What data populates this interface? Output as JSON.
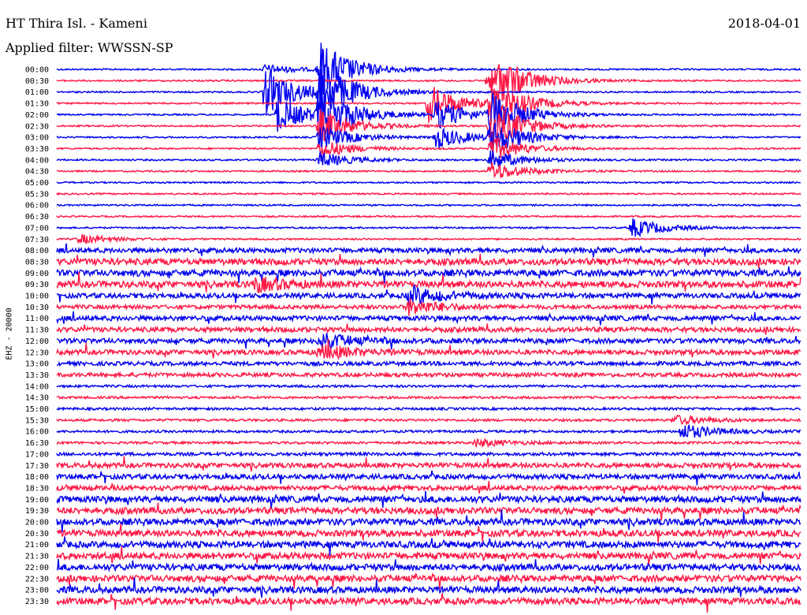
{
  "header": {
    "title": "HT Thira Isl. - Kameni",
    "date": "2018-04-01",
    "filter": "Applied filter: WWSSN-SP",
    "channel": "EHZ - 20000"
  },
  "colors": {
    "blue": "#0000ee",
    "red": "#ff1744"
  },
  "chart_data": {
    "type": "line",
    "title": "HT Thira Isl. - Kameni",
    "subtitle": "Applied filter: WWSSN-SP",
    "ylabel": "EHZ - 20000",
    "tick_labels": [
      "00:00",
      "00:30",
      "01:00",
      "01:30",
      "02:00",
      "02:30",
      "03:00",
      "03:30",
      "04:00",
      "04:30",
      "05:00",
      "05:30",
      "06:00",
      "06:30",
      "07:00",
      "07:30",
      "08:00",
      "08:30",
      "09:00",
      "09:30",
      "10:00",
      "10:30",
      "11:00",
      "11:30",
      "12:00",
      "12:30",
      "13:00",
      "13:30",
      "14:00",
      "14:30",
      "15:00",
      "15:30",
      "16:00",
      "16:30",
      "17:00",
      "17:30",
      "18:00",
      "18:30",
      "19:00",
      "19:30",
      "20:00",
      "20:30",
      "21:00",
      "21:30",
      "22:00",
      "22:30",
      "23:00",
      "23:30"
    ],
    "series_colors": [
      "blue",
      "red"
    ],
    "x_range_minutes_per_line": [
      0,
      30
    ],
    "noise_level_per_line": [
      1,
      1,
      1,
      1,
      1,
      1,
      1,
      1,
      1,
      1,
      1,
      1,
      1,
      1,
      1,
      1,
      3,
      4,
      4,
      4,
      3,
      2.5,
      3,
      3,
      3,
      3,
      2.5,
      2.5,
      1.5,
      1.5,
      1.5,
      1.5,
      1.5,
      1.5,
      2,
      3,
      3,
      3,
      4,
      4,
      4,
      4,
      4,
      4,
      4,
      4,
      4,
      4
    ],
    "events": [
      {
        "line": 0,
        "minute": 8.4,
        "amplitude": 6
      },
      {
        "line": 0,
        "minute": 10.6,
        "amplitude": 36
      },
      {
        "line": 1,
        "minute": 17.4,
        "amplitude": 14
      },
      {
        "line": 1,
        "minute": 17.8,
        "amplitude": 22
      },
      {
        "line": 2,
        "minute": 8.4,
        "amplitude": 30
      },
      {
        "line": 2,
        "minute": 10.6,
        "amplitude": 36
      },
      {
        "line": 3,
        "minute": 15.0,
        "amplitude": 24
      },
      {
        "line": 3,
        "minute": 17.5,
        "amplitude": 30
      },
      {
        "line": 4,
        "minute": 8.9,
        "amplitude": 22
      },
      {
        "line": 4,
        "minute": 10.6,
        "amplitude": 34
      },
      {
        "line": 4,
        "minute": 15.3,
        "amplitude": 18
      },
      {
        "line": 4,
        "minute": 17.5,
        "amplitude": 28
      },
      {
        "line": 5,
        "minute": 10.6,
        "amplitude": 22
      },
      {
        "line": 5,
        "minute": 17.5,
        "amplitude": 30
      },
      {
        "line": 6,
        "minute": 10.6,
        "amplitude": 16
      },
      {
        "line": 6,
        "minute": 15.3,
        "amplitude": 14
      },
      {
        "line": 6,
        "minute": 17.5,
        "amplitude": 22
      },
      {
        "line": 7,
        "minute": 10.6,
        "amplitude": 12
      },
      {
        "line": 7,
        "minute": 17.5,
        "amplitude": 16
      },
      {
        "line": 8,
        "minute": 10.6,
        "amplitude": 10
      },
      {
        "line": 8,
        "minute": 17.5,
        "amplitude": 12
      },
      {
        "line": 9,
        "minute": 17.5,
        "amplitude": 12
      },
      {
        "line": 14,
        "minute": 23.2,
        "amplitude": 12
      },
      {
        "line": 15,
        "minute": 0.9,
        "amplitude": 6
      },
      {
        "line": 19,
        "minute": 8.0,
        "amplitude": 8
      },
      {
        "line": 20,
        "minute": 14.2,
        "amplitude": 12
      },
      {
        "line": 21,
        "minute": 14.2,
        "amplitude": 10
      },
      {
        "line": 24,
        "minute": 10.6,
        "amplitude": 10
      },
      {
        "line": 25,
        "minute": 10.6,
        "amplitude": 10
      },
      {
        "line": 31,
        "minute": 24.9,
        "amplitude": 6
      },
      {
        "line": 32,
        "minute": 25.2,
        "amplitude": 10
      },
      {
        "line": 33,
        "minute": 16.9,
        "amplitude": 5
      }
    ]
  }
}
